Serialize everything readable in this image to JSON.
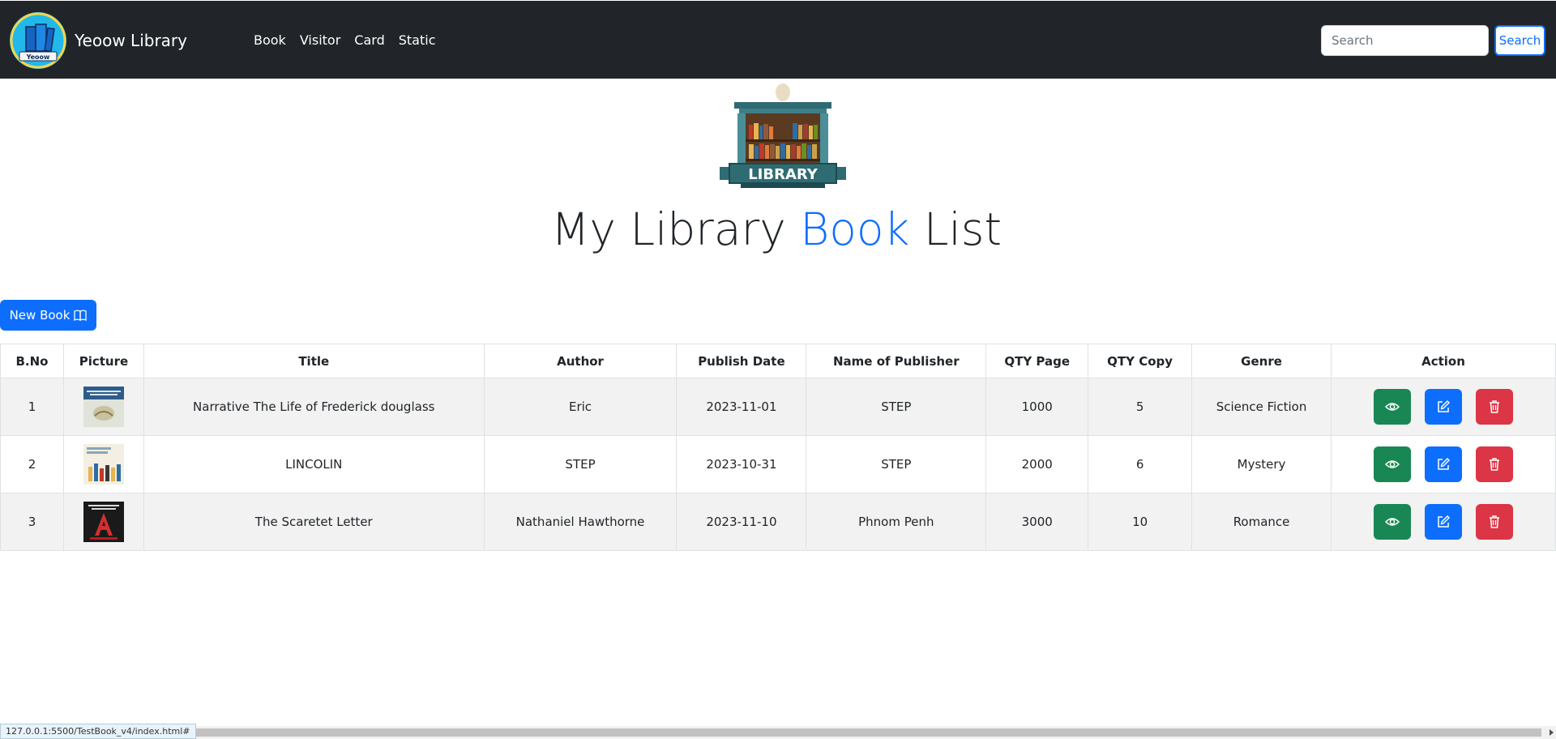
{
  "navbar": {
    "brand": "Yeoow Library",
    "logo_text": "Yeoow",
    "links": [
      "Book",
      "Visitor",
      "Card",
      "Static"
    ],
    "search_placeholder": "Search",
    "search_button": "Search"
  },
  "hero": {
    "logo_text": "LIBRARY",
    "title_part1": "My Library ",
    "title_accent": "Book",
    "title_part2": " List",
    "accent_color": "#0d6efd"
  },
  "new_book_button": {
    "label": "New Book",
    "icon": "book-icon"
  },
  "table": {
    "headers": [
      "B.No",
      "Picture",
      "Title",
      "Author",
      "Publish Date",
      "Name of Publisher",
      "QTY Page",
      "QTY Copy",
      "Genre",
      "Action"
    ],
    "rows": [
      {
        "no": "1",
        "picture": "cover-douglass",
        "title": "Narrative The Life of Frederick douglass",
        "author": "Eric",
        "publish_date": "2023-11-01",
        "publisher": "STEP",
        "qty_page": "1000",
        "qty_copy": "5",
        "genre": "Science Fiction"
      },
      {
        "no": "2",
        "picture": "cover-lincoln",
        "title": "LINCOLIN",
        "author": "STEP",
        "publish_date": "2023-10-31",
        "publisher": "STEP",
        "qty_page": "2000",
        "qty_copy": "6",
        "genre": "Mystery"
      },
      {
        "no": "3",
        "picture": "cover-scarlet",
        "title": "The Scaretet Letter",
        "author": "Nathaniel Hawthorne",
        "publish_date": "2023-11-10",
        "publisher": "Phnom Penh",
        "qty_page": "3000",
        "qty_copy": "10",
        "genre": "Romance"
      }
    ],
    "action_icons": [
      "eye-icon",
      "edit-icon",
      "trash-icon"
    ],
    "colors": {
      "view": "#198754",
      "edit": "#0d6efd",
      "delete": "#dc3545"
    }
  },
  "status": {
    "url": "127.0.0.1:5500/TestBook_v4/index.html#"
  }
}
